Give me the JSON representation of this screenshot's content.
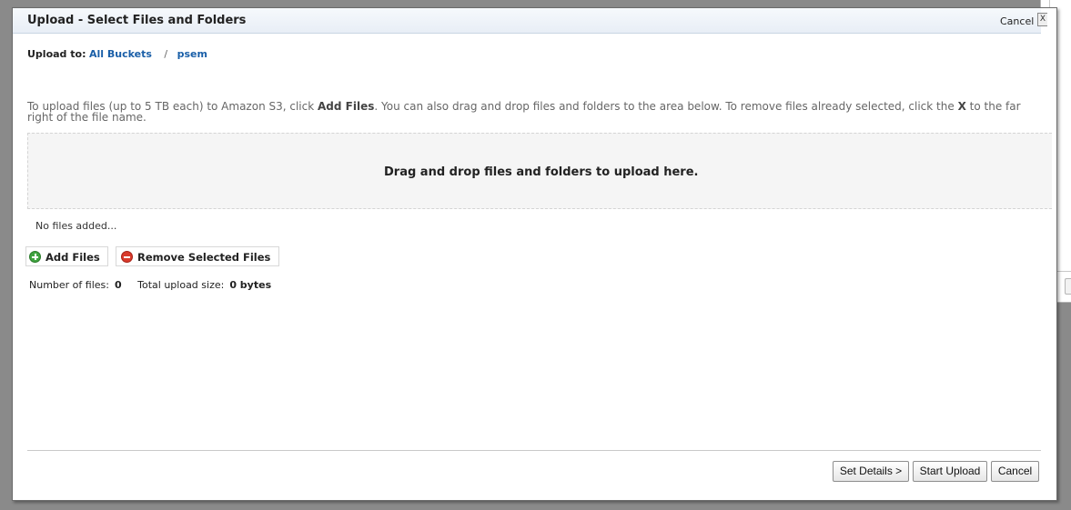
{
  "dialog": {
    "title": "Upload - Select Files and Folders",
    "title_cancel": "Cancel",
    "close_glyph": "X"
  },
  "upload_to": {
    "label": "Upload to:",
    "breadcrumb": [
      "All Buckets",
      "psem"
    ],
    "separator": "/"
  },
  "instructions": {
    "part1": "To upload files (up to 5 TB each) to Amazon S3, click ",
    "add_files": "Add Files",
    "part2": ". You can also drag and drop files and folders to the area below. To remove files already selected, click the ",
    "x": "X",
    "part3": " to the far right of the file name."
  },
  "dropzone": {
    "text": "Drag and drop files and folders to upload here."
  },
  "file_list": {
    "empty_text": "No files added..."
  },
  "actions": {
    "add_files": "Add Files",
    "remove_selected": "Remove Selected Files",
    "add_icon": "plus-circle-icon",
    "remove_icon": "minus-circle-icon"
  },
  "stats": {
    "num_files_label": "Number of files:",
    "num_files_value": "0",
    "total_size_label": "Total upload size:",
    "total_size_value": "0 bytes"
  },
  "footer": {
    "set_details": "Set Details >",
    "start_upload": "Start Upload",
    "cancel": "Cancel"
  },
  "colors": {
    "link": "#1a5fa8",
    "add_icon": "#3fa33f",
    "remove_icon": "#d93a2b"
  }
}
